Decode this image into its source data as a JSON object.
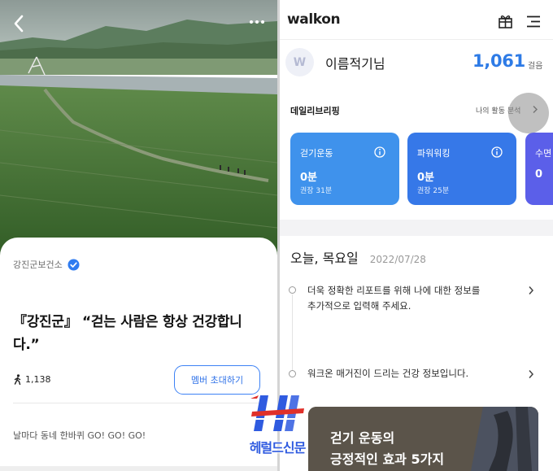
{
  "left_post": {
    "organization": "강진군보건소",
    "headline": "『강진군』 “걷는 사람은 항상 건강합니다.”",
    "member_count": "1,138",
    "invite_button": "멤버 초대하기",
    "slogan": "날마다 동네 한바퀴 GO! GO! GO!",
    "icons": {
      "back": "chevron-left-icon",
      "more": "more-dots-icon",
      "verified": "verified-badge-icon",
      "members": "walking-person-icon"
    }
  },
  "app": {
    "logo": "walkon",
    "icons": {
      "gift": "gift-box-icon",
      "menu": "hamburger-menu-icon"
    }
  },
  "profile": {
    "avatar_letter": "W",
    "name": "이름적기님",
    "steps": "1,061",
    "steps_unit": "걸음"
  },
  "briefing": {
    "title": "데일리브리핑",
    "link": "나의 활동 분석",
    "cards": [
      {
        "label": "걷기운동",
        "value": "0분",
        "goal": "권장 31분",
        "color": "#3f92ec"
      },
      {
        "label": "파워워킹",
        "value": "0분",
        "goal": "권장 25분",
        "color": "#3678e8"
      },
      {
        "label": "수면",
        "value": "",
        "goal": "",
        "color": "#5b5fe9"
      }
    ]
  },
  "today": {
    "label": "오늘, 목요일",
    "date": "2022/07/28",
    "items": [
      {
        "line1": "더욱 정확한 리포트를 위해 나에 대한 정보를",
        "line2": "추가적으로 입력해 주세요."
      },
      {
        "line1": "워크온 매거진이 드리는 건강 정보입니다.",
        "line2": ""
      }
    ]
  },
  "magazine": {
    "title_line1": "걷기 운동의",
    "title_line2": "긍정적인 효과 5가지"
  },
  "watermark": {
    "text": "헤럴드신문"
  },
  "colors": {
    "accent_blue": "#2e7be6",
    "invite_border": "#3d82f5",
    "watermark_blue": "#2f5be0",
    "watermark_red": "#e0302a"
  }
}
